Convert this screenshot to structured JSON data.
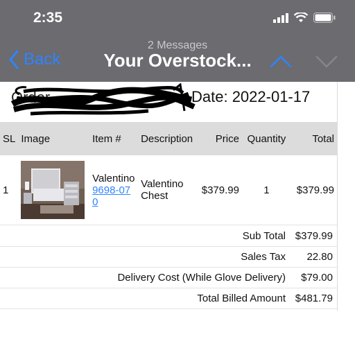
{
  "status_bar": {
    "time": "2:35"
  },
  "nav": {
    "back_label": "Back",
    "subtitle": "2 Messages",
    "title": "Your Overstock..."
  },
  "order": {
    "label": "Order",
    "date": "Date: 2022-01-17"
  },
  "table": {
    "headers": [
      "SL",
      "Image",
      "Item #",
      "Description",
      "Price",
      "Quantity",
      "Total"
    ],
    "rows": [
      {
        "sl": "1",
        "image_icon": "bedroom-set-photo",
        "item_name": "Valentino",
        "item_number": "9698-070",
        "description": "Valentino Chest",
        "price": "$379.99",
        "quantity": "1",
        "total": "$379.99"
      }
    ]
  },
  "summary": {
    "sub_total_label": "Sub Total",
    "sub_total": "$379.99",
    "sales_tax_label": "Sales Tax",
    "sales_tax": "22.80",
    "delivery_label": "Delivery Cost (While Glove Delivery)",
    "delivery": "$79.00",
    "total_billed_label": "Total Billed Amount",
    "total_billed": "$481.79"
  },
  "colors": {
    "header_bar": "#6b6b70",
    "link_blue": "#2f84ff",
    "table_header": "#dcdcdc"
  }
}
